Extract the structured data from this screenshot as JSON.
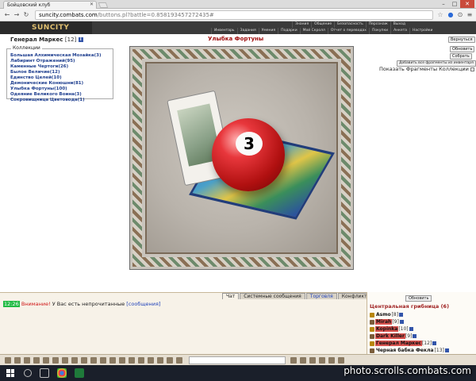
{
  "browser": {
    "tab_title": "Бойцовский клуб",
    "url_host": "suncity.combats.com",
    "url_path": "/buttons.pl?battle=0.858193457272435#"
  },
  "game": {
    "logo": "SUNCITY",
    "nav_top": [
      "Знания",
      "Общение",
      "Безопасность",
      "Персонаж",
      "Выход"
    ],
    "nav_bottom": [
      "Инвентарь",
      "Задания",
      "Умения",
      "Подарки",
      "Мой Скролл",
      "Отчет о переводах",
      "Покупки",
      "Анкета",
      "Настройки"
    ]
  },
  "character": {
    "name": "Генерал Маркес",
    "level": "[12]"
  },
  "collections": {
    "legend": "Коллекции",
    "items": [
      "Большая Алхимическая Мозайка(3)",
      "Лабиринт Отражений(95)",
      "Каменные Чертоги(26)",
      "Былое Величие(12)",
      "Единство Целей(10)",
      "Демонические Конюшни(81)",
      "Улыбка Фортуны(100)",
      "Одеяние Великого Воина(3)",
      "Сокровищница Цветовода(1)"
    ]
  },
  "main": {
    "heading": "Улыбка Фортуны",
    "ball_number": "3",
    "buttons": {
      "back": "Вернуться",
      "refresh": "Обновить",
      "collect": "Собрать",
      "add_fragments": "Добавить все фрагменты из инвентаря"
    },
    "show_fragments": "Показать Фрагменты Коллекции"
  },
  "chat": {
    "tabs": [
      "Чат",
      "Системные сообщения",
      "Торговля",
      "Конфликты"
    ],
    "message": {
      "time": "12:26",
      "warning": "Внимание!",
      "text": " У Вас есть непрочитанные ",
      "link": "[сообщения]"
    }
  },
  "sidebar": {
    "refresh": "Обновить",
    "location": "Центральная грибница (6)",
    "players": [
      {
        "name": "Asmo",
        "level": "[8]",
        "highlight": false
      },
      {
        "name": "Mirah",
        "level": "[9]",
        "highlight": true
      },
      {
        "name": "Kopinka",
        "level": "[10]",
        "highlight": true
      },
      {
        "name": "Dark Killer",
        "level": "[9]",
        "highlight": true
      },
      {
        "name": "Генерал Маркес",
        "level": "[12]",
        "highlight": true
      },
      {
        "name": "Черная бабка Фекла",
        "level": "[13]",
        "highlight": false
      }
    ]
  },
  "watermark": "photo.scrolls.combats.com"
}
